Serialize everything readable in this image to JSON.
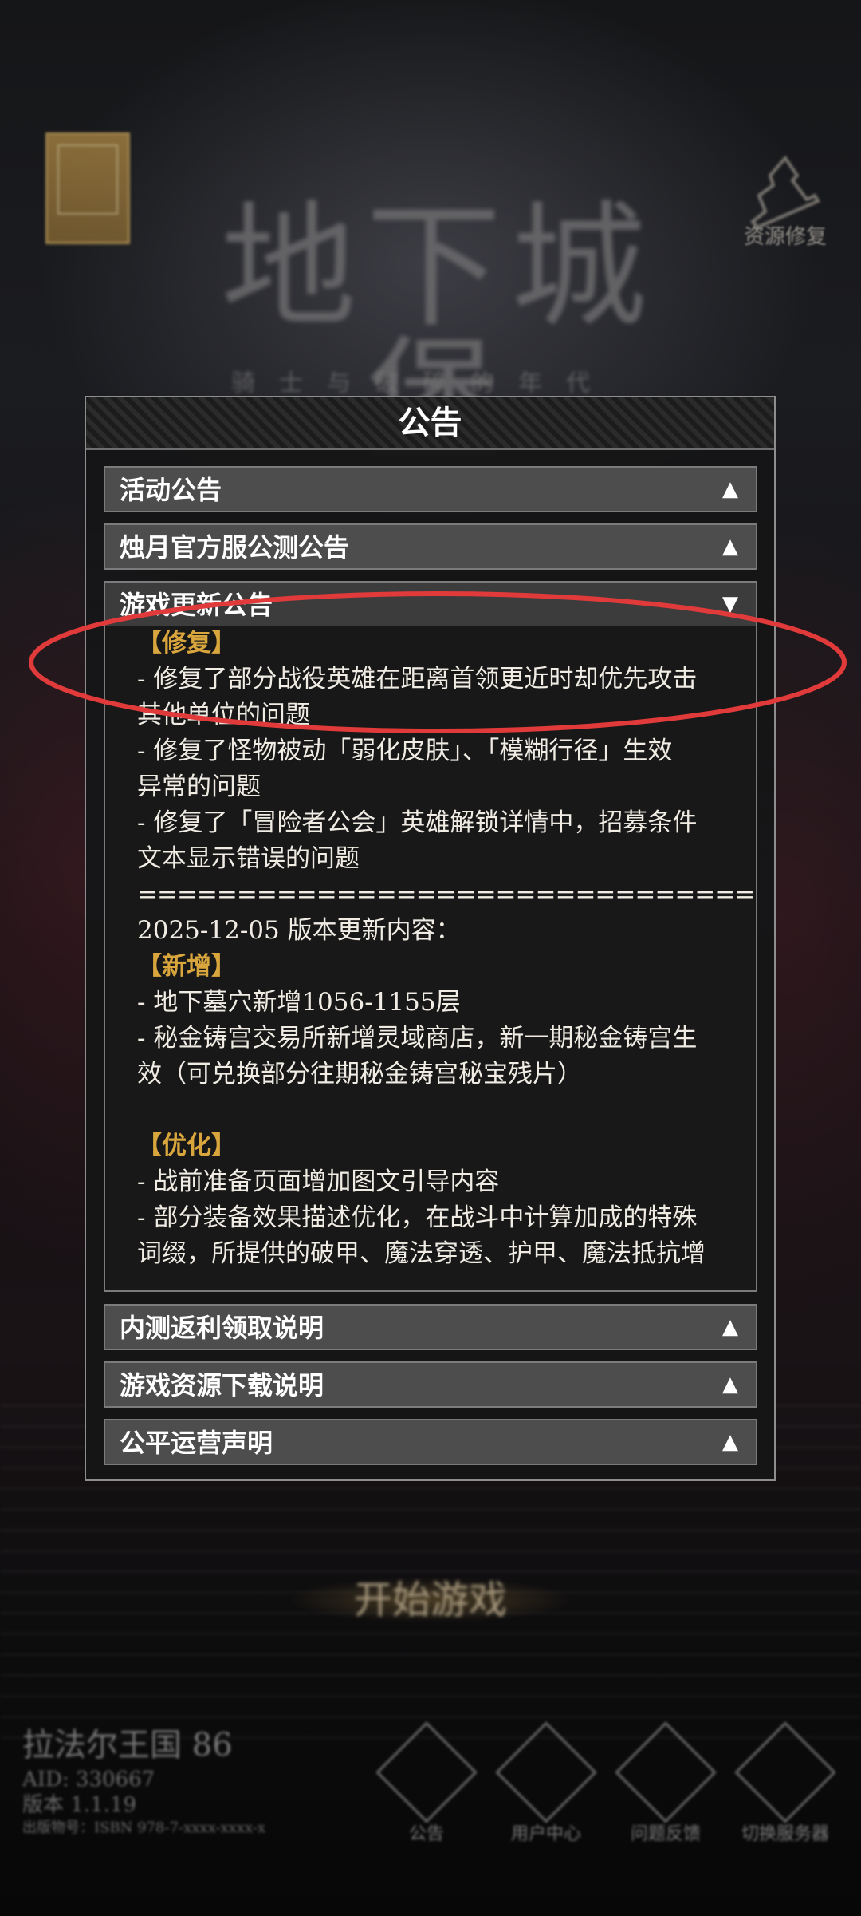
{
  "background": {
    "game_title": "地下城堡",
    "game_subtitle": "骑士与破碎的年代",
    "repair_label": "资源修复",
    "start_button": "开始游戏",
    "server_name": "拉法尔王国 86",
    "aid": "AID: 330667",
    "version": "版本 1.1.19",
    "license": "出版物号：ISBN 978-7-xxxx-xxxx-x"
  },
  "bottom_buttons": [
    {
      "label": "公告",
      "icon": "announcement-icon"
    },
    {
      "label": "用户中心",
      "icon": "user-center-icon"
    },
    {
      "label": "问题反馈",
      "icon": "feedback-icon"
    },
    {
      "label": "切换服务器",
      "icon": "server-switch-icon"
    }
  ],
  "dialog": {
    "title": "公告",
    "sections": [
      {
        "label": "活动公告",
        "arrow": "▲"
      },
      {
        "label": "烛月官方服公测公告",
        "arrow": "▲"
      },
      {
        "label": "游戏更新公告",
        "arrow": "▼"
      },
      {
        "label": "内测返利领取说明",
        "arrow": "▲"
      },
      {
        "label": "游戏资源下载说明",
        "arrow": "▲"
      },
      {
        "label": "公平运营声明",
        "arrow": "▲"
      }
    ],
    "content_lines": [
      "【修复】",
      "- 修复了部分战役英雄在距离首领更近时却优先攻击",
      "其他单位的问题",
      "- 修复了怪物被动「弱化皮肤」、「模糊行径」生效",
      "异常的问题",
      "- 修复了「冒险者公会」英雄解锁详情中，招募条件",
      "文本显示错误的问题",
      "=====================================",
      "2025-12-05 版本更新内容：",
      "【新增】",
      "- 地下墓穴新增1056-1155层",
      "- 秘金铸宫交易所新增灵域商店，新一期秘金铸宫生",
      "效（可兑换部分往期秘金铸宫秘宝残片）",
      "",
      "【优化】",
      "- 战前准备页面增加图文引导内容",
      "- 部分装备效果描述优化，在战斗中计算加成的特殊",
      "词缀，所提供的破甲、魔法穿透、护甲、魔法抵抗增"
    ]
  },
  "colors": {
    "accent_gold": "#d9a63e",
    "annotation_red": "#e03a3a",
    "header_bg": "#4d4d4e"
  }
}
